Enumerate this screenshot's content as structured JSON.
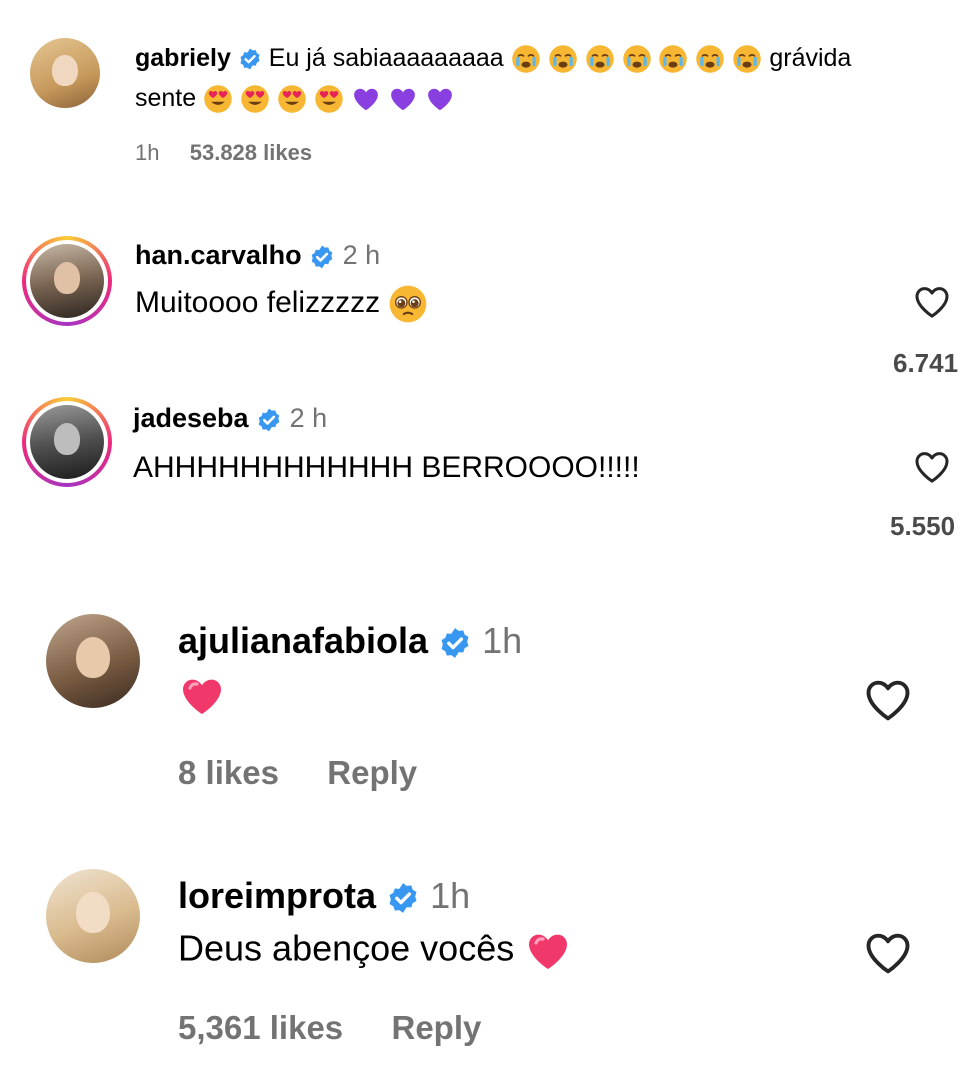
{
  "caption": {
    "username": "gabriely",
    "text_part1": "Eu já sabiaaaaaaaaa",
    "text_part2": "grávida",
    "text_part3": "sente",
    "time": "1h",
    "likes": "53.828 likes"
  },
  "comments": [
    {
      "username": "han.carvalho",
      "time": "2 h",
      "text": "Muitoooo felizzzzz",
      "like_count": "6.741"
    },
    {
      "username": "jadeseba",
      "time": "2 h",
      "text": "AHHHHHHHHHHHH BERROOOO!!!!!",
      "like_count": "5.550"
    },
    {
      "username": "ajulianafabiola",
      "time": "1h",
      "text": "",
      "likes": "8 likes",
      "reply": "Reply"
    },
    {
      "username": "loreimprota",
      "time": "1h",
      "text": "Deus abençoe vocês",
      "likes": "5,361 likes",
      "reply": "Reply"
    }
  ],
  "colors": {
    "verified": "#3897f0",
    "muted": "#737373",
    "heart_emoji": "#f0386b",
    "purple_heart": "#8a3fe0"
  },
  "icons": [
    "verified-badge-icon",
    "heart-outline-icon",
    "crying-face-emoji",
    "heart-eyes-emoji",
    "purple-heart-emoji",
    "pleading-face-emoji",
    "red-heart-emoji"
  ]
}
